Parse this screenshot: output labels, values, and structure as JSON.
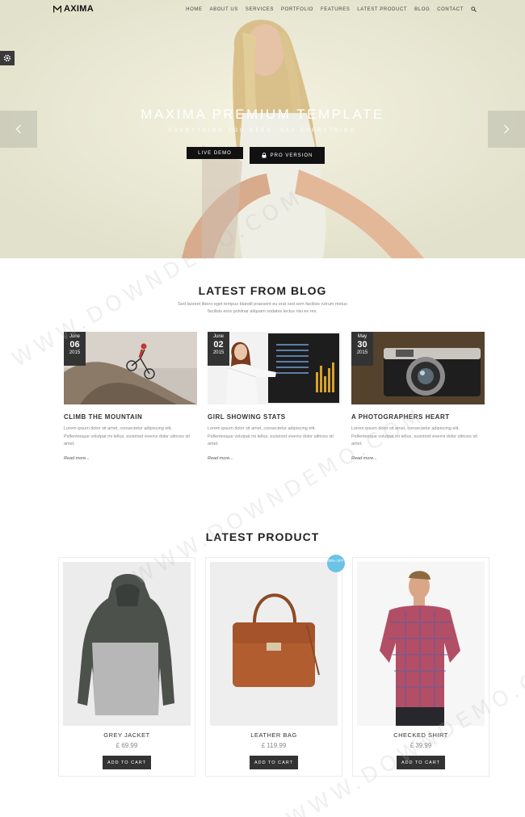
{
  "header": {
    "logo_text": "AXIMA",
    "nav": [
      "HOME",
      "ABOUT US",
      "SERVICES",
      "PORTFOLIO",
      "FEATURES",
      "LATEST PRODUCT",
      "BLOG",
      "CONTACT"
    ]
  },
  "hero": {
    "title": "MAXIMA PREMIUM TEMPLATE",
    "subtitle": "EVERYTHING YOU NEED, SAY EVERYTHING",
    "live_demo_label": "LIVE DEMO",
    "pro_version_label": "PRO VERSION"
  },
  "blog": {
    "title": "LATEST FROM BLOG",
    "intro": "Sed laoreet libero eget tempus blandit praesent eu erat sed sem facilisis rutrum metus facilisis eros pulvinar aliquam sodales lectus nisi ex rex.",
    "posts": [
      {
        "month": "June",
        "day": "06",
        "year": "2015",
        "title": "CLIMB THE MOUNTAIN",
        "text": "Lorem ipsum dolor sit amet, consectetur adipiscing elit. Pellentesque volutpat mi tellus, euismod viverra dolor ultrices sit amet.",
        "more": "Read more..."
      },
      {
        "month": "June",
        "day": "02",
        "year": "2015",
        "title": "GIRL SHOWING STATS",
        "text": "Lorem ipsum dolor sit amet, consectetur adipiscing elit. Pellentesque volutpat mi tellus, euismod viverra dolor ultrices sit amet.",
        "more": "Read more..."
      },
      {
        "month": "May",
        "day": "30",
        "year": "2015",
        "title": "A PHOTOGRAPHERS HEART",
        "text": "Lorem ipsum dolor sit amet, consectetur adipiscing elit. Pellentesque volutpat mi tellus, euismod viverra dolor ultrices sit amet.",
        "more": "Read more..."
      }
    ]
  },
  "products": {
    "title": "LATEST PRODUCT",
    "items": [
      {
        "name": "GREY JACKET",
        "price": "£ 69.99",
        "button": "ADD TO CART"
      },
      {
        "name": "LEATHER BAG",
        "price": "£ 119.99",
        "button": "ADD TO CART",
        "badge": "80% OFF"
      },
      {
        "name": "CHECKED SHIRT",
        "price": "£ 39.99",
        "button": "ADD TO CART"
      }
    ]
  },
  "watermark": "WWW.DOWNDEMO.COM",
  "colors": {
    "hero_bg": "#e9e8d4",
    "dark": "#333333",
    "sale_badge": "#6cc3e8"
  }
}
